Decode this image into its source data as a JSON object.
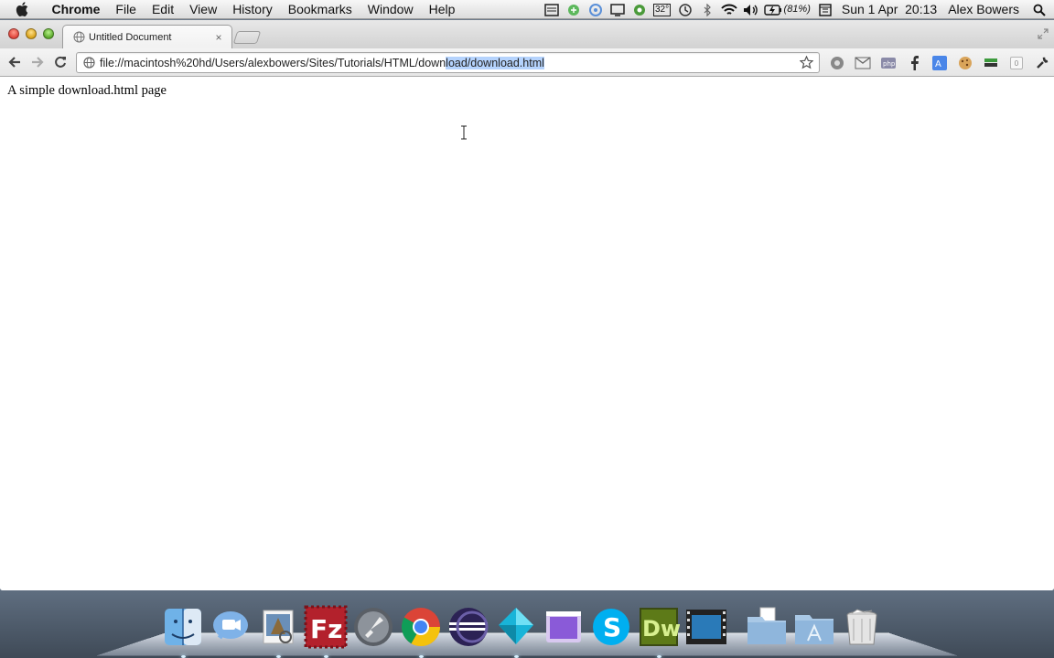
{
  "menubar": {
    "app_name": "Chrome",
    "items": [
      "File",
      "Edit",
      "View",
      "History",
      "Bookmarks",
      "Window",
      "Help"
    ],
    "temperature": "32°",
    "battery": "(81%)",
    "datetime": "Sun 1 Apr  20:13",
    "user": "Alex Bowers"
  },
  "browser": {
    "tab_title": "Untitled Document",
    "tab_close": "×",
    "url_plain": "file://macintosh%20hd/Users/alexbowers/Sites/Tutorials/HTML/down",
    "url_selected": "load/download.html",
    "extension_badge_count": "0"
  },
  "page": {
    "body_text": "A simple download.html page"
  },
  "dock": {
    "apps": [
      "finder-icon",
      "facetime-icon",
      "preview-icon",
      "filezilla-icon",
      "launchpad-icon",
      "chrome-icon",
      "eclipse-icon",
      "dart-icon",
      "stage-icon",
      "skype-icon",
      "dreamweaver-icon",
      "video-icon"
    ],
    "stacks": [
      "documents-folder-icon",
      "applications-folder-icon",
      "trash-icon"
    ],
    "filezilla_label": "Fz",
    "dreamweaver_label": "Dw",
    "skype_label": "S"
  }
}
